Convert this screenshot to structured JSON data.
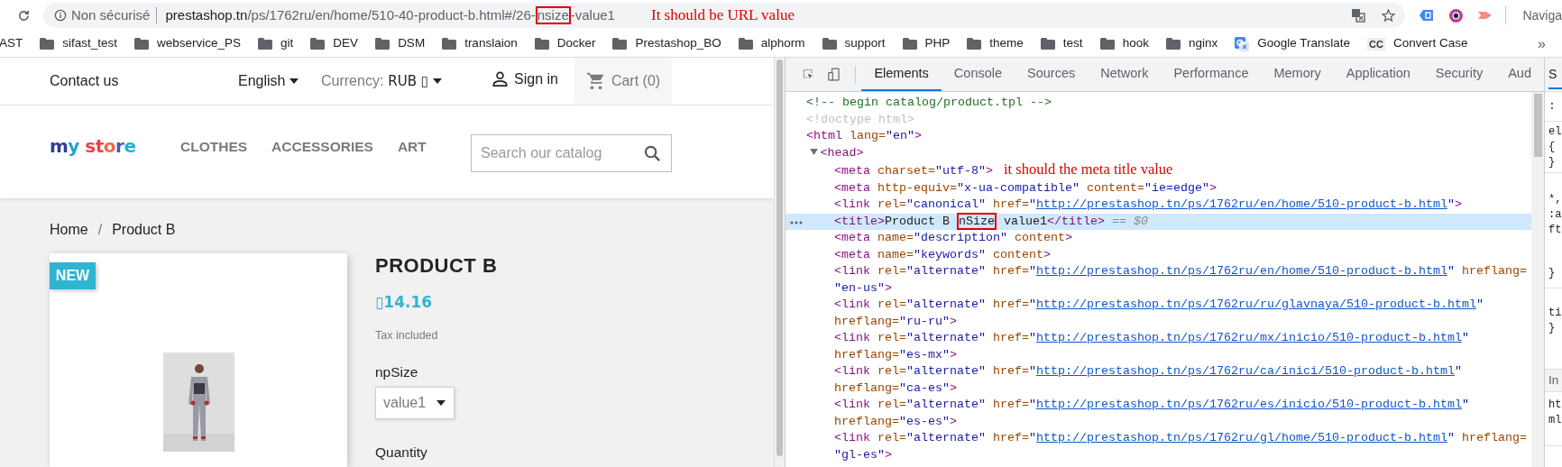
{
  "browser": {
    "toolbar": {
      "security_label": "Non sécurisé",
      "url": [
        {
          "text": "prestashop.tn",
          "kind": "host"
        },
        {
          "text": "/ps/1762ru/en/home/510-40-product-b.html#/26-",
          "kind": "path"
        },
        {
          "text": "nsize",
          "kind": "boxed"
        },
        {
          "text": "-value1",
          "kind": "path"
        }
      ],
      "annotation": "It should be URL value",
      "profile_label": "Naviga"
    },
    "bookmarks": [
      {
        "label": "AST",
        "kind": "plain"
      },
      {
        "label": "sifast_test",
        "kind": "folder"
      },
      {
        "label": "webservice_PS",
        "kind": "folder"
      },
      {
        "label": "git",
        "kind": "folder"
      },
      {
        "label": "DEV",
        "kind": "folder"
      },
      {
        "label": "DSM",
        "kind": "folder"
      },
      {
        "label": "translaion",
        "kind": "folder"
      },
      {
        "label": "Docker",
        "kind": "folder"
      },
      {
        "label": "Prestashop_BO",
        "kind": "folder"
      },
      {
        "label": "alphorm",
        "kind": "folder"
      },
      {
        "label": "support",
        "kind": "folder"
      },
      {
        "label": "PHP",
        "kind": "folder"
      },
      {
        "label": "theme",
        "kind": "folder"
      },
      {
        "label": "test",
        "kind": "folder"
      },
      {
        "label": "hook",
        "kind": "folder"
      },
      {
        "label": "nginx",
        "kind": "folder"
      },
      {
        "label": "Google Translate",
        "kind": "translate"
      },
      {
        "label": "Convert Case",
        "kind": "badge",
        "badge": "CC"
      }
    ],
    "bookmarks_more": "»"
  },
  "page": {
    "header": {
      "contact": "Contact us",
      "language": "English",
      "currency_label": "Currency:",
      "currency_value": "RUB ▯",
      "sign_in": "Sign in",
      "cart": "Cart (0)"
    },
    "logo": "my store",
    "menu": [
      "CLOTHES",
      "ACCESSORIES",
      "ART"
    ],
    "search": {
      "placeholder": "Search our catalog"
    },
    "breadcrumb": {
      "items": [
        "Home",
        "Product B"
      ],
      "separator": "/"
    },
    "product": {
      "badge": "NEW",
      "title": "PRODUCT B",
      "price": "▯14.16",
      "tax_note": "Tax included",
      "variant_label": "npSize",
      "variant_value": "value1",
      "quantity_label": "Quantity"
    }
  },
  "devtools": {
    "tabs": [
      {
        "label": "Elements",
        "selected": true
      },
      {
        "label": "Console",
        "selected": false
      },
      {
        "label": "Sources",
        "selected": false
      },
      {
        "label": "Network",
        "selected": false
      },
      {
        "label": "Performance",
        "selected": false
      },
      {
        "label": "Memory",
        "selected": false
      },
      {
        "label": "Application",
        "selected": false
      },
      {
        "label": "Security",
        "selected": false
      },
      {
        "label": "Aud",
        "selected": false
      }
    ],
    "dom": [
      {
        "selected": false,
        "segments": [
          {
            "text": "<!-- begin catalog/product.tpl -->",
            "kind": "comment"
          }
        ]
      },
      {
        "selected": false,
        "segments": [
          {
            "text": "<!doctype html>",
            "kind": "doctype"
          }
        ]
      },
      {
        "selected": false,
        "segments": [
          {
            "text": "<html",
            "kind": "tag"
          },
          {
            "text": " lang=",
            "kind": "name"
          },
          {
            "text": "\"en\"",
            "kind": "value"
          },
          {
            "text": ">",
            "kind": "tag"
          }
        ],
        "children": [
          {
            "selected": false,
            "expanded": true,
            "segments": [
              {
                "text": "<head>",
                "kind": "tag"
              }
            ],
            "children": [
              {
                "selected": false,
                "segments": [
                  {
                    "text": "<meta",
                    "kind": "tag"
                  },
                  {
                    "text": " charset=",
                    "kind": "name"
                  },
                  {
                    "text": "\"utf-8\"",
                    "kind": "value"
                  },
                  {
                    "text": ">",
                    "kind": "tag"
                  },
                  {
                    "text": "it should the meta title value",
                    "kind": "note"
                  }
                ]
              },
              {
                "selected": false,
                "segments": [
                  {
                    "text": "<meta",
                    "kind": "tag"
                  },
                  {
                    "text": " http-equiv=",
                    "kind": "name"
                  },
                  {
                    "text": "\"x-ua-compatible\"",
                    "kind": "value"
                  },
                  {
                    "text": " content=",
                    "kind": "name"
                  },
                  {
                    "text": "\"ie=edge\"",
                    "kind": "value"
                  },
                  {
                    "text": ">",
                    "kind": "tag"
                  }
                ]
              },
              {
                "selected": false,
                "segments": [
                  {
                    "text": "<link",
                    "kind": "tag"
                  },
                  {
                    "text": " rel=",
                    "kind": "name"
                  },
                  {
                    "text": "\"canonical\"",
                    "kind": "value"
                  },
                  {
                    "text": " href=",
                    "kind": "name"
                  },
                  {
                    "text": "\"",
                    "kind": "value"
                  },
                  {
                    "text": "http://prestashop.tn/ps/1762ru/en/home/510-product-b.html",
                    "kind": "link"
                  },
                  {
                    "text": "\"",
                    "kind": "value"
                  },
                  {
                    "text": ">",
                    "kind": "tag"
                  }
                ]
              },
              {
                "selected": true,
                "segments": [
                  {
                    "text": "<title>",
                    "kind": "tag"
                  },
                  {
                    "text": "Product B ",
                    "kind": "text"
                  },
                  {
                    "text": "nSize",
                    "kind": "boxed"
                  },
                  {
                    "text": " value1",
                    "kind": "text"
                  },
                  {
                    "text": "</title>",
                    "kind": "tag"
                  },
                  {
                    "text": " == $0",
                    "kind": "ref"
                  }
                ]
              },
              {
                "selected": false,
                "segments": [
                  {
                    "text": "<meta",
                    "kind": "tag"
                  },
                  {
                    "text": " name=",
                    "kind": "name"
                  },
                  {
                    "text": "\"description\"",
                    "kind": "value"
                  },
                  {
                    "text": " content",
                    "kind": "name"
                  },
                  {
                    "text": ">",
                    "kind": "tag"
                  }
                ]
              },
              {
                "selected": false,
                "segments": [
                  {
                    "text": "<meta",
                    "kind": "tag"
                  },
                  {
                    "text": " name=",
                    "kind": "name"
                  },
                  {
                    "text": "\"keywords\"",
                    "kind": "value"
                  },
                  {
                    "text": " content",
                    "kind": "name"
                  },
                  {
                    "text": ">",
                    "kind": "tag"
                  }
                ]
              },
              {
                "selected": false,
                "segments": [
                  {
                    "text": "<link",
                    "kind": "tag"
                  },
                  {
                    "text": " rel=",
                    "kind": "name"
                  },
                  {
                    "text": "\"alternate\"",
                    "kind": "value"
                  },
                  {
                    "text": " href=",
                    "kind": "name"
                  },
                  {
                    "text": "\"",
                    "kind": "value"
                  },
                  {
                    "text": "http://prestashop.tn/ps/1762ru/en/home/510-product-b.html",
                    "kind": "link"
                  },
                  {
                    "text": "\"",
                    "kind": "value"
                  },
                  {
                    "text": " hreflang=",
                    "kind": "name"
                  },
                  {
                    "text": "\"en-us\"",
                    "kind": "value"
                  },
                  {
                    "text": ">",
                    "kind": "tag"
                  }
                ]
              },
              {
                "selected": false,
                "segments": [
                  {
                    "text": "<link",
                    "kind": "tag"
                  },
                  {
                    "text": " rel=",
                    "kind": "name"
                  },
                  {
                    "text": "\"alternate\"",
                    "kind": "value"
                  },
                  {
                    "text": " href=",
                    "kind": "name"
                  },
                  {
                    "text": "\"",
                    "kind": "value"
                  },
                  {
                    "text": "http://prestashop.tn/ps/1762ru/ru/glavnaya/510-product-b.html",
                    "kind": "link"
                  },
                  {
                    "text": "\"",
                    "kind": "value"
                  },
                  {
                    "text": " hreflang=",
                    "kind": "name"
                  },
                  {
                    "text": "\"ru-ru\"",
                    "kind": "value"
                  },
                  {
                    "text": ">",
                    "kind": "tag"
                  }
                ]
              },
              {
                "selected": false,
                "segments": [
                  {
                    "text": "<link",
                    "kind": "tag"
                  },
                  {
                    "text": " rel=",
                    "kind": "name"
                  },
                  {
                    "text": "\"alternate\"",
                    "kind": "value"
                  },
                  {
                    "text": " href=",
                    "kind": "name"
                  },
                  {
                    "text": "\"",
                    "kind": "value"
                  },
                  {
                    "text": "http://prestashop.tn/ps/1762ru/mx/inicio/510-product-b.html",
                    "kind": "link"
                  },
                  {
                    "text": "\"",
                    "kind": "value"
                  },
                  {
                    "text": " hreflang=",
                    "kind": "name"
                  },
                  {
                    "text": "\"es-mx\"",
                    "kind": "value"
                  },
                  {
                    "text": ">",
                    "kind": "tag"
                  }
                ]
              },
              {
                "selected": false,
                "segments": [
                  {
                    "text": "<link",
                    "kind": "tag"
                  },
                  {
                    "text": " rel=",
                    "kind": "name"
                  },
                  {
                    "text": "\"alternate\"",
                    "kind": "value"
                  },
                  {
                    "text": " href=",
                    "kind": "name"
                  },
                  {
                    "text": "\"",
                    "kind": "value"
                  },
                  {
                    "text": "http://prestashop.tn/ps/1762ru/ca/inici/510-product-b.html",
                    "kind": "link"
                  },
                  {
                    "text": "\"",
                    "kind": "value"
                  },
                  {
                    "text": " hreflang=",
                    "kind": "name"
                  },
                  {
                    "text": "\"ca-es\"",
                    "kind": "value"
                  },
                  {
                    "text": ">",
                    "kind": "tag"
                  }
                ]
              },
              {
                "selected": false,
                "segments": [
                  {
                    "text": "<link",
                    "kind": "tag"
                  },
                  {
                    "text": " rel=",
                    "kind": "name"
                  },
                  {
                    "text": "\"alternate\"",
                    "kind": "value"
                  },
                  {
                    "text": " href=",
                    "kind": "name"
                  },
                  {
                    "text": "\"",
                    "kind": "value"
                  },
                  {
                    "text": "http://prestashop.tn/ps/1762ru/es/inicio/510-product-b.html",
                    "kind": "link"
                  },
                  {
                    "text": "\"",
                    "kind": "value"
                  },
                  {
                    "text": " hreflang=",
                    "kind": "name"
                  },
                  {
                    "text": "\"es-es\"",
                    "kind": "value"
                  },
                  {
                    "text": ">",
                    "kind": "tag"
                  }
                ]
              },
              {
                "selected": false,
                "segments": [
                  {
                    "text": "<link",
                    "kind": "tag"
                  },
                  {
                    "text": " rel=",
                    "kind": "name"
                  },
                  {
                    "text": "\"alternate\"",
                    "kind": "value"
                  },
                  {
                    "text": " href=",
                    "kind": "name"
                  },
                  {
                    "text": "\"",
                    "kind": "value"
                  },
                  {
                    "text": "http://prestashop.tn/ps/1762ru/gl/home/510-product-b.html",
                    "kind": "link"
                  },
                  {
                    "text": "\"",
                    "kind": "value"
                  },
                  {
                    "text": " hreflang=",
                    "kind": "name"
                  },
                  {
                    "text": "\"gl-es\"",
                    "kind": "value"
                  },
                  {
                    "text": ">",
                    "kind": "tag"
                  }
                ]
              }
            ]
          }
        ]
      }
    ],
    "styles_pane": {
      "sections": [
        {
          "kind": "tab",
          "lines": [
            "S"
          ]
        },
        {
          "kind": "filter",
          "lines": [
            ":"
          ]
        },
        {
          "kind": "rule",
          "lines": [
            "el",
            "{",
            "}"
          ]
        },
        {
          "kind": "rule",
          "lines": [
            "*,",
            ":a",
            "ft",
            "}"
          ]
        },
        {
          "kind": "rule",
          "lines": [
            "ti",
            "}"
          ]
        },
        {
          "kind": "header",
          "lines": [
            "In"
          ]
        },
        {
          "kind": "rule",
          "lines": [
            "ht",
            "ml"
          ]
        }
      ]
    }
  }
}
